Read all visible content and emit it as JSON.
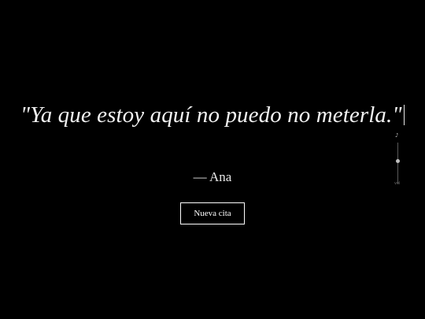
{
  "quote": {
    "text": "\"Ya que estoy aquí no puedo no meterla.\""
  },
  "author": {
    "text": "— Ana"
  },
  "new_quote_button": {
    "label": "Nueva cita"
  },
  "audio": {
    "icon": "music-note-icon",
    "glyph": "♪",
    "volume_level": 0.5,
    "volume_label": "vol"
  },
  "colors": {
    "background": "#000000",
    "text": "#ffffff"
  }
}
